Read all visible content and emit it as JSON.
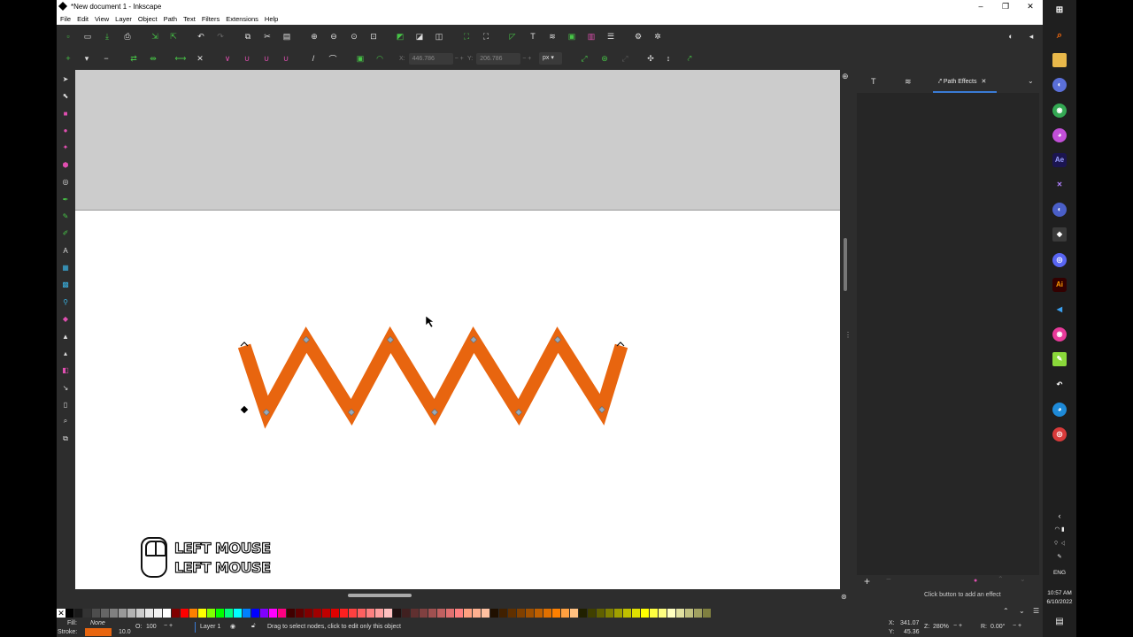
{
  "window": {
    "title": "*New document 1 - Inkscape",
    "controls": [
      "–",
      "❐",
      "✕"
    ]
  },
  "menu": [
    "File",
    "Edit",
    "View",
    "Layer",
    "Object",
    "Path",
    "Text",
    "Filters",
    "Extensions",
    "Help"
  ],
  "toolbar": {
    "x_label": "X:",
    "x_value": "446.786",
    "y_label": "Y:",
    "y_value": "206.786",
    "unit": "px"
  },
  "dock": {
    "active_tab": "Path Effects",
    "hint": "Click button to add an effect"
  },
  "overlay": {
    "line1": "LEFT MOUSE",
    "line2": "LEFT MOUSE"
  },
  "status": {
    "fill_label": "Fill:",
    "fill_value": "None",
    "stroke_label": "Stroke:",
    "stroke_width": "10.0",
    "stroke_color": "#e8650f",
    "opacity_label": "O:",
    "opacity_value": "100",
    "layer": "Layer 1",
    "message": "Drag to select nodes, click to edit only this object",
    "cursor_x_label": "X:",
    "cursor_x": "341.07",
    "cursor_y_label": "Y:",
    "cursor_y": "45.36",
    "zoom_label": "Z:",
    "zoom": "280%",
    "rotation_label": "R:",
    "rotation": "0.00°"
  },
  "taskbar": {
    "language": "ENG",
    "time": "10:57 AM",
    "date": "6/10/2022"
  },
  "colors": {
    "zigzag": "#e8650f",
    "canvas_margin": "#cccccc",
    "accent": "#3a7bd5"
  }
}
